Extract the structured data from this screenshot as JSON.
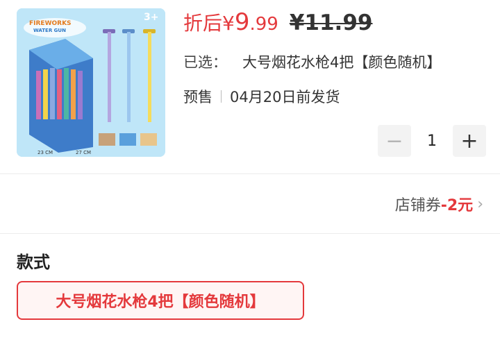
{
  "product": {
    "image_alt": "FIREWORKS WATER GUN",
    "image_badge": "3+"
  },
  "price": {
    "prefix": "折后",
    "currency": "¥",
    "integer": "9",
    "decimal": ".99",
    "original": "¥11.99"
  },
  "selected": {
    "label": "已选：",
    "value": "大号烟花水枪4把【颜色随机】"
  },
  "presale": {
    "tag": "预售",
    "shipping": "04月20日前发货"
  },
  "quantity": {
    "value": "1",
    "minus": "−",
    "plus": "+"
  },
  "coupon": {
    "label": "店铺券",
    "amount": "-2元",
    "chevron": "›"
  },
  "style_section": {
    "title": "款式",
    "options": [
      "大号烟花水枪4把【颜色随机】"
    ]
  },
  "colors": {
    "accent": "#e4393c",
    "muted": "#f3f3f3"
  }
}
